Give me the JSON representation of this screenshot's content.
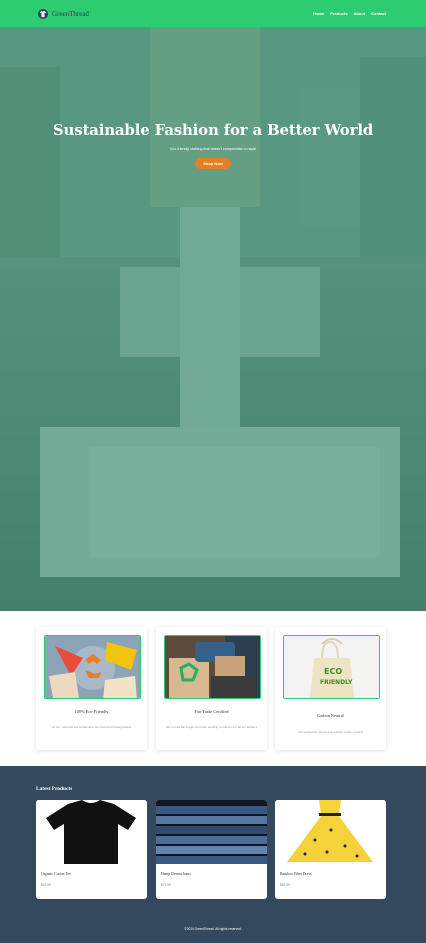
{
  "header": {
    "brand": "GreenThread",
    "logo_icon": "shirt-icon",
    "nav": [
      "Home",
      "Products",
      "About",
      "Contact"
    ],
    "background": "#2ecc71"
  },
  "hero": {
    "title": "Sustainable Fashion for a Better World",
    "subtitle": "Eco-friendly clothing that doesn't compromise on style",
    "button": "Shop Now",
    "button_color": "#e67e22"
  },
  "features": [
    {
      "title": "100% Eco-Friendly",
      "text": "All our materials are sustainably sourced and biodegradable",
      "image": "recycle-symbol-with-clothes"
    },
    {
      "title": "Fair Trade Certified",
      "text": "We ensure fair wages and safe working conditions for all our artisans",
      "image": "recycling-box-with-clothes"
    },
    {
      "title": "Carbon Neutral",
      "text": "Our production process is entirely carbon neutral",
      "image": "eco-friendly-tote-bag"
    }
  ],
  "products": {
    "heading": "Latest Products",
    "items": [
      {
        "name": "Organic Cotton Tee",
        "price": "$29.99",
        "image": "black-t-shirt"
      },
      {
        "name": "Hemp Denim Jeans",
        "price": "$79.99",
        "image": "folded-denim-stack"
      },
      {
        "name": "Bamboo Fiber Dress",
        "price": "$69.99",
        "image": "yellow-patterned-dress"
      }
    ]
  },
  "footer": {
    "text": "©2024 GreenThread. All rights reserved."
  },
  "colors": {
    "green": "#2ecc71",
    "dark": "#34495e",
    "orange": "#e67e22"
  }
}
